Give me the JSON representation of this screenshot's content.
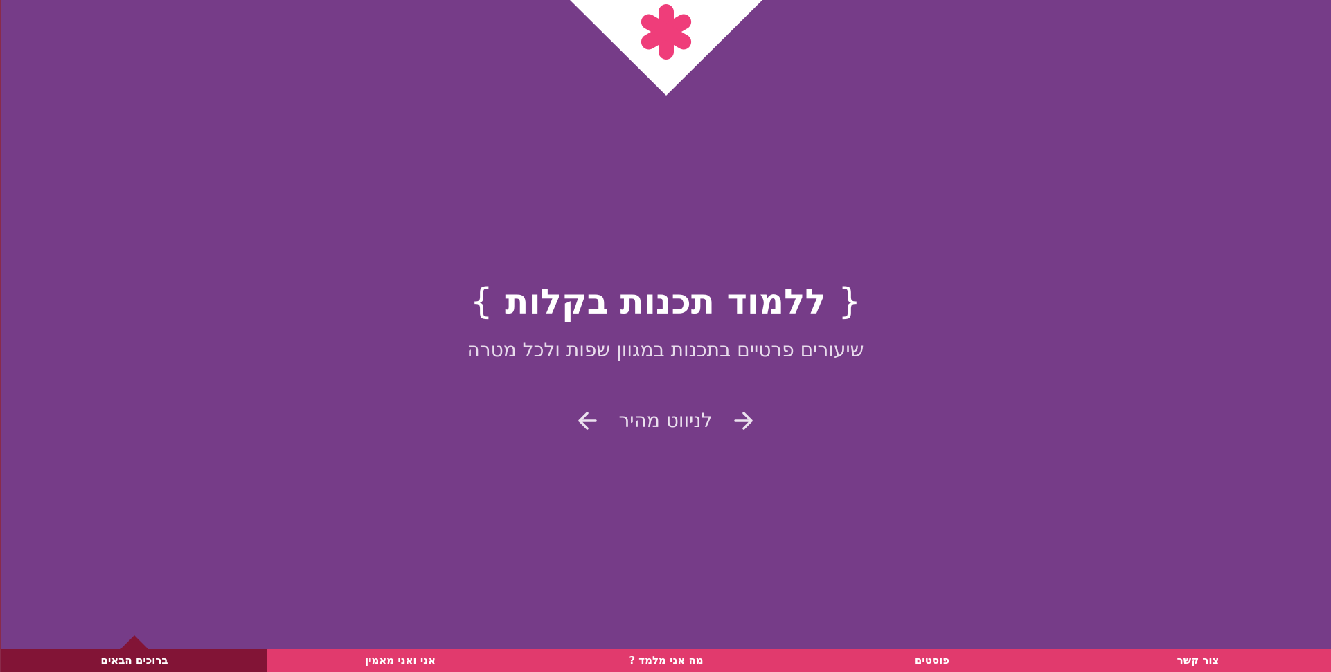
{
  "colors": {
    "background": "#763c88",
    "accent_pink": "#ef3d7a",
    "nav_bar": "#e13a6d",
    "nav_active": "#821436"
  },
  "logo": {
    "icon": "asterisk-icon"
  },
  "hero": {
    "brace_open": "{",
    "title": "ללמוד תכנות בקלות",
    "brace_close": "}",
    "subtitle": "שיעורים פרטיים בתכנות במגוון שפות ולכל מטרה"
  },
  "quick_nav": {
    "label": "לניווט מהיר",
    "prev_icon": "arrow-right-icon",
    "next_icon": "arrow-left-icon"
  },
  "bottom_nav": {
    "items": [
      {
        "label": "ברוכים הבאים",
        "active": true
      },
      {
        "label": "אני ואני מאמין",
        "active": false
      },
      {
        "label": "מה אני מלמד ?",
        "active": false
      },
      {
        "label": "פוסטים",
        "active": false
      },
      {
        "label": "צור קשר",
        "active": false
      }
    ]
  }
}
